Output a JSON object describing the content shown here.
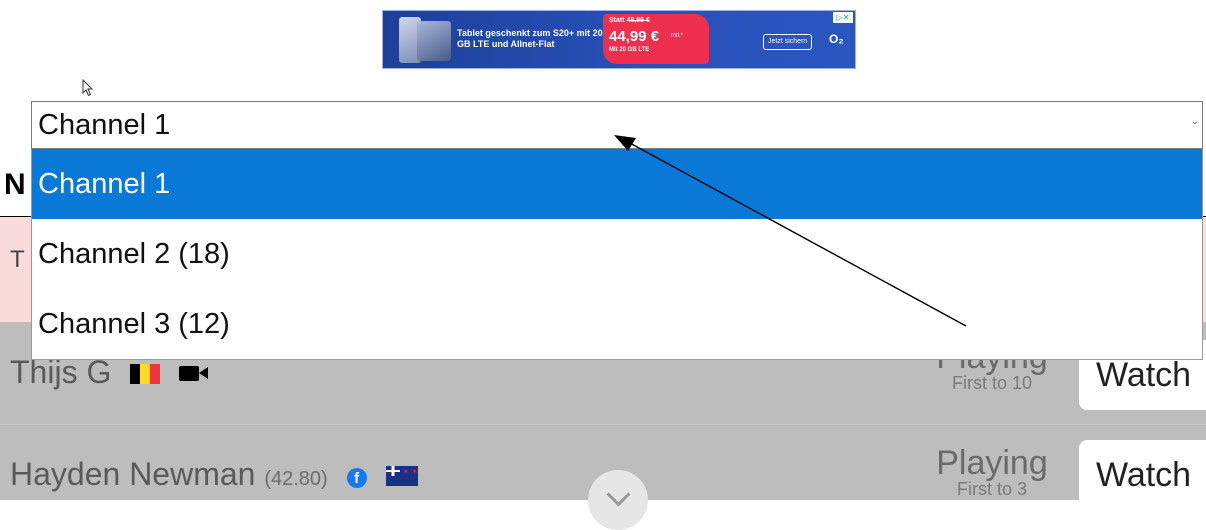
{
  "ad": {
    "headline": "Tablet geschenkt zum S20+ mit 20 GB LTE und Allnet-Flat",
    "old_price_prefix": "Statt",
    "old_price": "48,99 €",
    "price": "44,99 €",
    "price_suffix": "mtl.*",
    "data_line": "Mit 20 GB LTE",
    "cta": "Jetzt sichern",
    "brand": "O₂",
    "adchoices": "▷✕"
  },
  "page": {
    "heading_fragment": "N",
    "band_fragment": "T"
  },
  "select": {
    "value": "Channel 1",
    "arrow": "⌄",
    "options": [
      "Channel 1",
      "Channel 2 (18)",
      "Channel 3 (12)"
    ],
    "selected_index": 0
  },
  "players": [
    {
      "name": "Thijs G",
      "rating": "",
      "flag": "belgium-flag",
      "extra_icon": "video-camera-icon",
      "status": "Playing",
      "format": "First to 10",
      "button": "Watch"
    },
    {
      "name": "Hayden Newman",
      "rating": "(42.80)",
      "flag": "new-zealand-flag",
      "extra_icon": "facebook-icon",
      "status": "Playing",
      "format": "First to 3",
      "button": "Watch"
    }
  ],
  "colors": {
    "selection_blue": "#0a78d7",
    "row_gray": "#bdbdbd",
    "band_pink": "#fbdcdc"
  }
}
